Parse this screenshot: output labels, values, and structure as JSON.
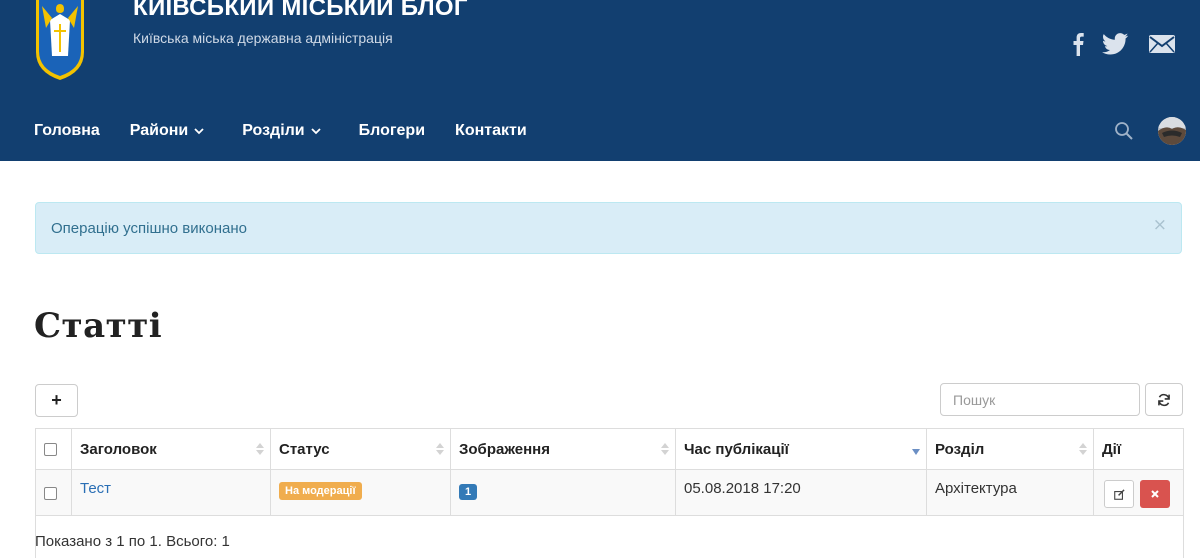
{
  "header": {
    "title": "КИЇВСЬКИЙ МІСЬКИЙ БЛОГ",
    "subtitle": "Київська міська державна адміністрація",
    "background": "#123f70",
    "social": [
      "facebook-icon",
      "twitter-icon",
      "mail-icon"
    ]
  },
  "nav": {
    "items": [
      {
        "label": "Головна",
        "dropdown": false
      },
      {
        "label": "Райони",
        "dropdown": true
      },
      {
        "label": "Розділи",
        "dropdown": true
      },
      {
        "label": "Блогери",
        "dropdown": false
      },
      {
        "label": "Контакти",
        "dropdown": false
      }
    ]
  },
  "alert": {
    "text": "Операцію успішно виконано",
    "close": "×"
  },
  "page": {
    "title": "Статті"
  },
  "toolbar": {
    "add_label": "+",
    "search_placeholder": "Пошук"
  },
  "table": {
    "columns": [
      "Заголовок",
      "Статус",
      "Зображення",
      "Час публікації",
      "Розділ",
      "Дії"
    ],
    "rows": [
      {
        "title": "Тест",
        "status": "На модерації",
        "images": "1",
        "published": "05.08.2018 17:20",
        "section": "Архітектура"
      }
    ]
  },
  "pagination": {
    "info": "Показано з 1 по 1. Всього: 1"
  },
  "colors": {
    "alert_bg": "#d9edf7",
    "status_badge": "#f0ad4e",
    "count_badge": "#337ab7",
    "delete_button": "#d9534f",
    "link": "#2a6fb5"
  }
}
